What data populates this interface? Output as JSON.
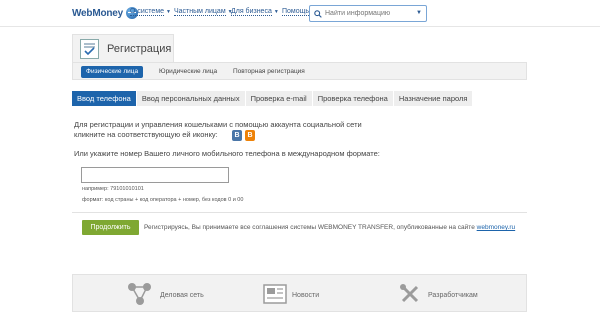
{
  "header": {
    "logo": "WebMoney",
    "nav": [
      "О системе",
      "Частным лицам",
      "Для бизнеса",
      "Помощь"
    ],
    "search_placeholder": "Найти информацию"
  },
  "page": {
    "title": "Регистрация",
    "subtabs": [
      "Физические лица",
      "Юридические лица",
      "Повторная регистрация"
    ]
  },
  "steps": [
    "Ввод телефона",
    "Ввод персональных данных",
    "Проверка e-mail",
    "Проверка телефона",
    "Назначение пароля"
  ],
  "form": {
    "social_line1": "Для регистрации и управления кошельками с помощью аккаунта социальной сети",
    "social_line2": "кликните на соответствующую ей иконку:",
    "social_icons": [
      "В",
      "В"
    ],
    "phone_label": "Или укажите номер Вашего личного мобильного телефона в международном формате:",
    "phone_value": "",
    "example": "например: 79101010101",
    "format": "формат: код страны + код оператора + номер, без кодов 0 и 00",
    "submit": "Продолжить",
    "agree_text": "Регистрируясь, Вы принимаете все соглашения системы WEBMONEY TRANSFER, опубликованные на сайте ",
    "agree_link": "webmoney.ru"
  },
  "footer": [
    "Деловая сеть",
    "Новости",
    "Разработчикам"
  ],
  "colors": {
    "accent": "#1d64ab",
    "button": "#7fa832",
    "vk": "#4a76a8",
    "ok": "#ee8208"
  }
}
